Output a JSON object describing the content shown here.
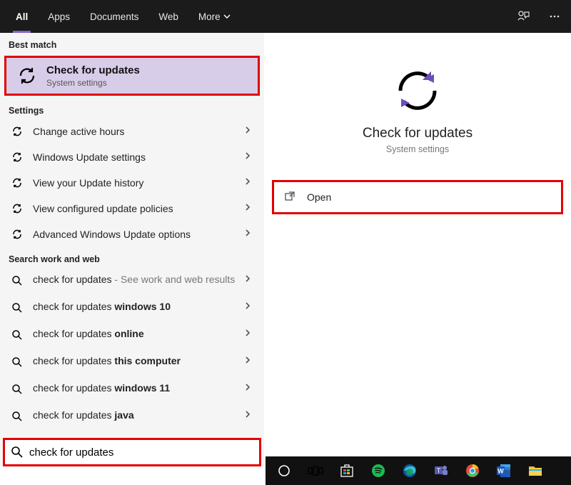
{
  "topbar": {
    "tabs": [
      "All",
      "Apps",
      "Documents",
      "Web",
      "More"
    ]
  },
  "left": {
    "bestmatch_header": "Best match",
    "bestmatch": {
      "title": "Check for updates",
      "sub": "System settings"
    },
    "settings_header": "Settings",
    "settings_items": [
      "Change active hours",
      "Windows Update settings",
      "View your Update history",
      "View configured update policies",
      "Advanced Windows Update options"
    ],
    "web_header": "Search work and web",
    "web_items": [
      {
        "prefix": "check for updates",
        "suffix": " - See work and web results",
        "bold": ""
      },
      {
        "prefix": "check for updates ",
        "suffix": "",
        "bold": "windows 10"
      },
      {
        "prefix": "check for updates ",
        "suffix": "",
        "bold": "online"
      },
      {
        "prefix": "check for updates ",
        "suffix": "",
        "bold": "this computer"
      },
      {
        "prefix": "check for updates ",
        "suffix": "",
        "bold": "windows 11"
      },
      {
        "prefix": "check for updates ",
        "suffix": "",
        "bold": "java"
      }
    ],
    "search_value": "check for updates"
  },
  "right": {
    "title": "Check for updates",
    "sub": "System settings",
    "open_label": "Open"
  }
}
